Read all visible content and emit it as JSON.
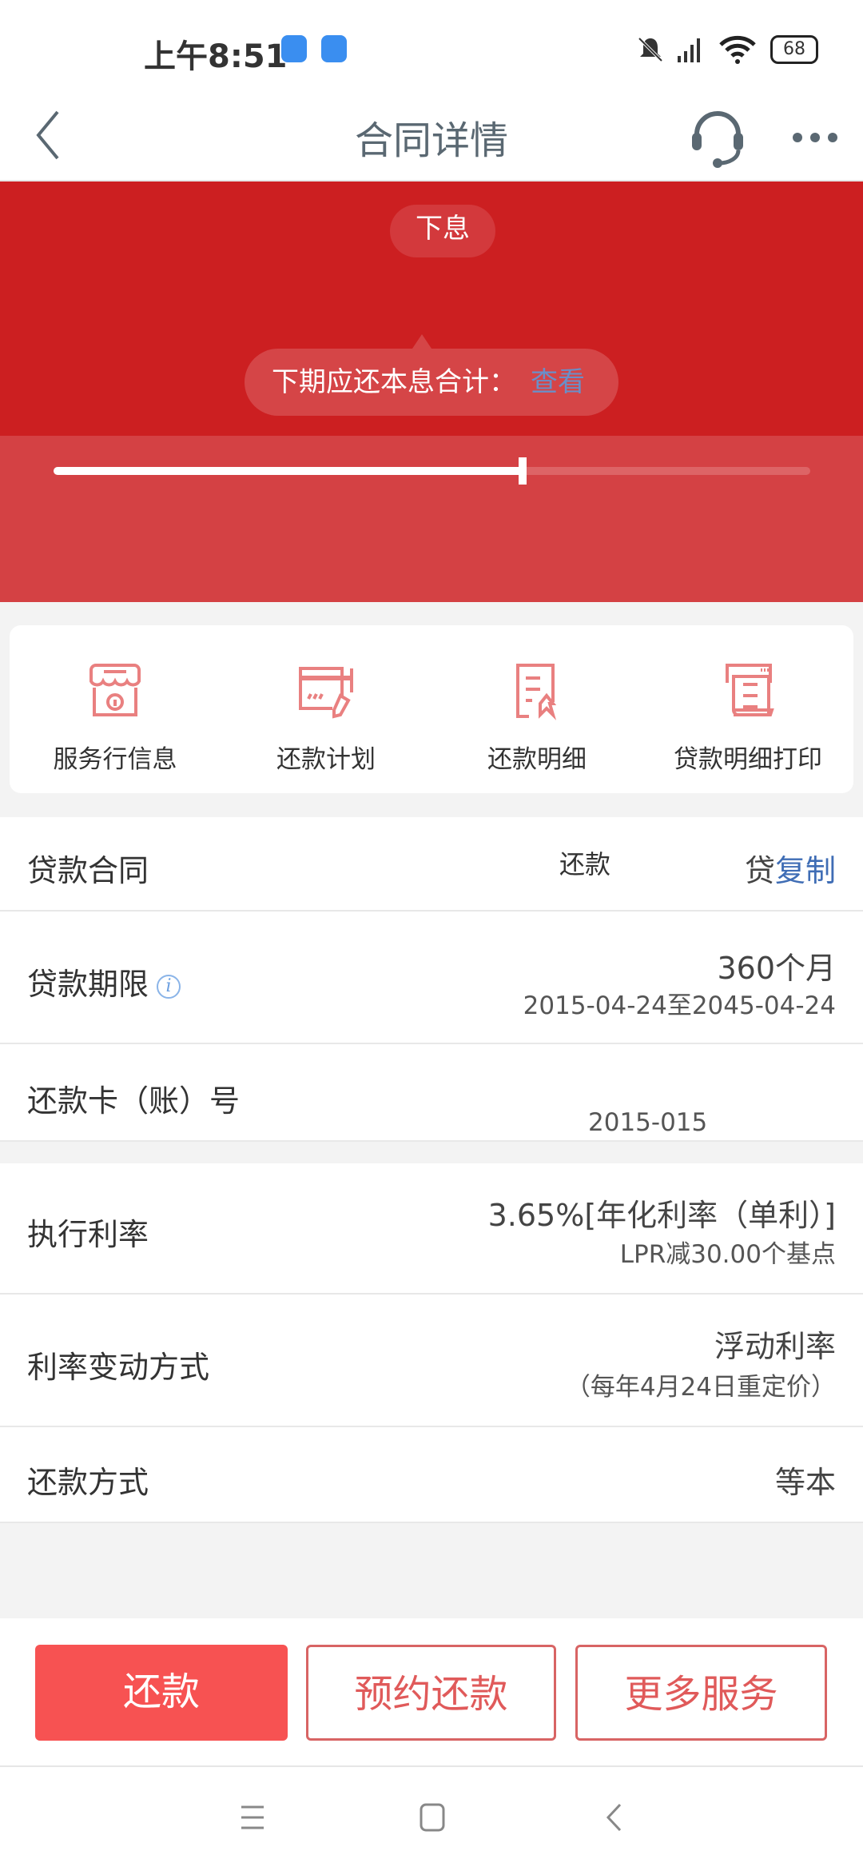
{
  "status_bar": {
    "time": "上午8:51",
    "battery": "68",
    "icons": [
      "video-app-icon",
      "app-icon",
      "mute-icon",
      "signal-icon",
      "wifi-icon",
      "battery-icon"
    ]
  },
  "header": {
    "title": "合同详情",
    "back_icon": "chevron-left-icon",
    "support_icon": "headset-icon",
    "more_icon": "more-icon"
  },
  "banner": {
    "pill_text": "下息",
    "tooltip_label": "下期应还本息合计：",
    "tooltip_link": "查看",
    "progress": 0.62
  },
  "services": [
    {
      "label": "服务行信息",
      "icon": "store-info-icon"
    },
    {
      "label": "还款计划",
      "icon": "card-edit-icon"
    },
    {
      "label": "还款明细",
      "icon": "document-icon"
    },
    {
      "label": "贷款明细打印",
      "icon": "printer-icon"
    }
  ],
  "details": {
    "contract": {
      "label": "贷款合同",
      "mid": "还款",
      "value": "贷",
      "copy": "复制"
    },
    "term": {
      "label": "贷款期限",
      "value": "360个月",
      "sub": "2015-04-24至2045-04-24"
    },
    "card": {
      "label": "还款卡（账）号",
      "sub": "2015-015"
    },
    "rate": {
      "label": "执行利率",
      "value": "3.65%[年化利率（单利）]",
      "sub": "LPR减30.00个基点"
    },
    "rate_change": {
      "label": "利率变动方式",
      "value": "浮动利率",
      "sub": "（每年4月24日重定价）"
    },
    "method": {
      "label": "还款方式",
      "value": "等本"
    }
  },
  "actions": {
    "repay": "还款",
    "schedule": "预约还款",
    "more": "更多服务"
  },
  "colors": {
    "banner": "#cc1f21",
    "primary_button": "#f75252",
    "accent": "#e05a5a",
    "link": "#3f6db5"
  }
}
